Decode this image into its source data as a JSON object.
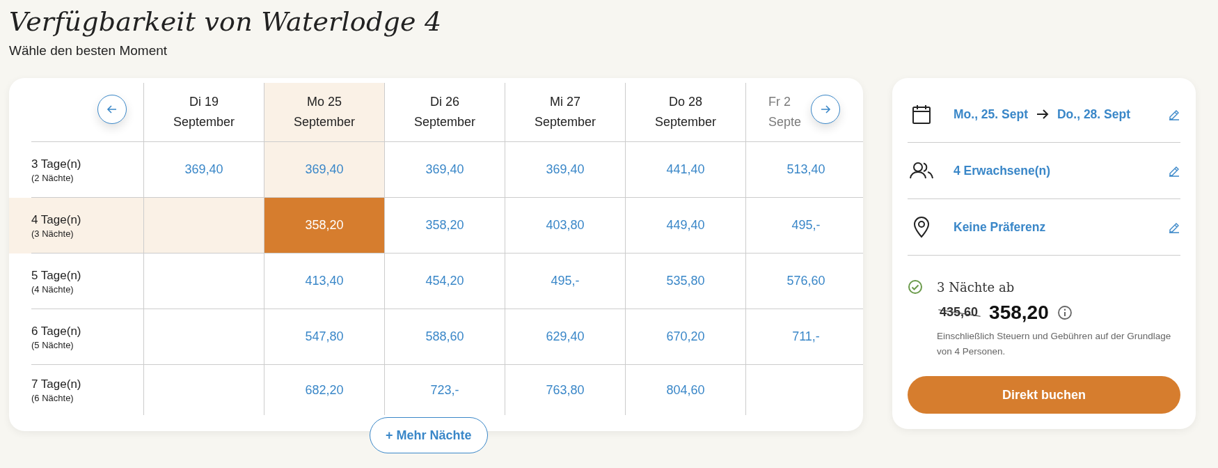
{
  "page": {
    "title": "Verfügbarkeit von Waterlodge 4",
    "subtitle": "Wähle den besten Moment"
  },
  "calendar": {
    "columns": [
      {
        "day": "Di 19",
        "month": "September",
        "selected": false,
        "faded": false
      },
      {
        "day": "Mo 25",
        "month": "September",
        "selected": true,
        "faded": false
      },
      {
        "day": "Di 26",
        "month": "September",
        "selected": false,
        "faded": false
      },
      {
        "day": "Mi 27",
        "month": "September",
        "selected": false,
        "faded": false
      },
      {
        "day": "Do 28",
        "month": "September",
        "selected": false,
        "faded": false
      },
      {
        "day": "Fr 2",
        "month": "Septe",
        "selected": false,
        "faded": true
      }
    ],
    "rows": [
      {
        "label": "3 Tage(n)",
        "sublabel": "(2 Nächte)",
        "selected": false,
        "cells": [
          "369,40",
          "369,40",
          "369,40",
          "369,40",
          "441,40",
          "513,40"
        ]
      },
      {
        "label": "4 Tage(n)",
        "sublabel": "(3 Nächte)",
        "selected": true,
        "cells": [
          null,
          "358,20",
          "358,20",
          "403,80",
          "449,40",
          "495,-"
        ]
      },
      {
        "label": "5 Tage(n)",
        "sublabel": "(4 Nächte)",
        "selected": false,
        "cells": [
          null,
          "413,40",
          "454,20",
          "495,-",
          "535,80",
          "576,60"
        ]
      },
      {
        "label": "6 Tage(n)",
        "sublabel": "(5 Nächte)",
        "selected": false,
        "cells": [
          null,
          "547,80",
          "588,60",
          "629,40",
          "670,20",
          "711,-"
        ]
      },
      {
        "label": "7 Tage(n)",
        "sublabel": "(6 Nächte)",
        "selected": false,
        "cells": [
          null,
          "682,20",
          "723,-",
          "763,80",
          "804,60",
          null
        ]
      }
    ],
    "more_button": "+ Mehr Nächte"
  },
  "summary": {
    "date_from": "Mo., 25. Sept",
    "date_to": "Do., 28. Sept",
    "guests": "4 Erwachsene(n)",
    "location": "Keine Präferenz",
    "nights_label": "3 Nächte ab",
    "old_price": "435,60",
    "price": "358,20",
    "note": "Einschließlich Steuern und Gebühren auf der Grundlage von 4 Personen.",
    "book_button": "Direkt buchen"
  }
}
